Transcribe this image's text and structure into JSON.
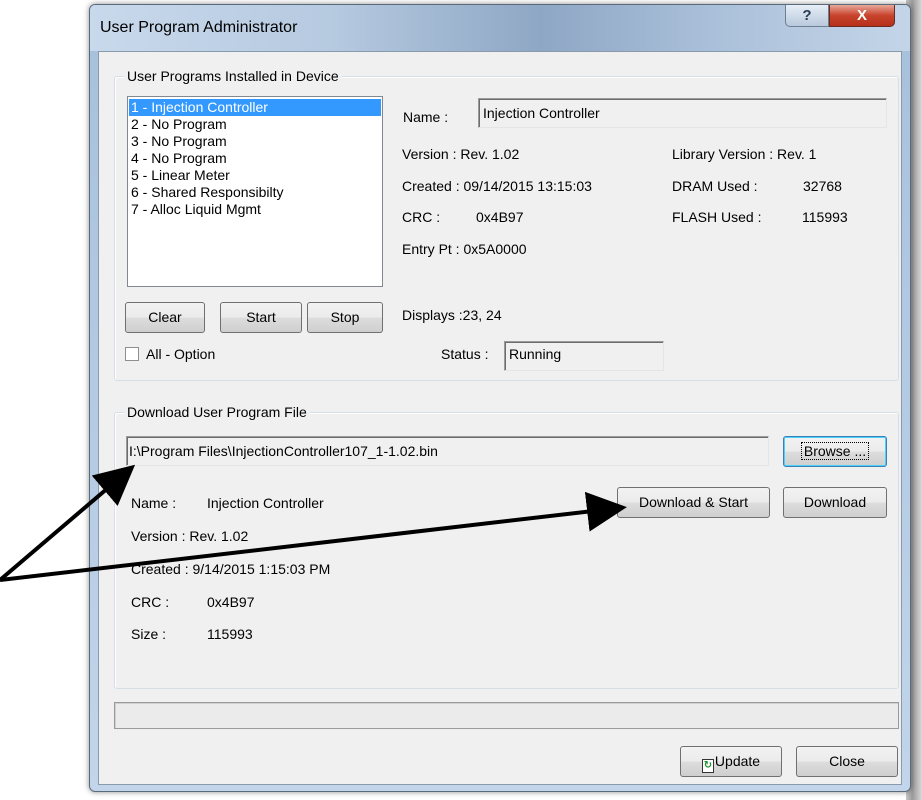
{
  "window": {
    "title": "User Program Administrator",
    "help_glyph": "?",
    "close_glyph": "X"
  },
  "installed": {
    "group_title": "User Programs Installed in Device",
    "programs": [
      "1 - Injection Controller",
      "2 - No Program",
      "3 - No Program",
      "4 - No Program",
      "5 - Linear Meter",
      "6 - Shared Responsibilty",
      "7 - Alloc Liquid Mgmt"
    ],
    "selected_index": 0,
    "name_label": "Name :",
    "name_value": "Injection Controller",
    "version": "Version : Rev. 1.02",
    "created": "Created : 09/14/2015 13:15:03",
    "crc_label": "CRC :",
    "crc_value": "0x4B97",
    "entry_pt": "Entry Pt : 0x5A0000",
    "library_version": "Library Version : Rev. 1",
    "dram_label": "DRAM Used :",
    "dram_value": "32768",
    "flash_label": "FLASH Used :",
    "flash_value": "115993",
    "displays": "Displays :23, 24",
    "status_label": "Status :",
    "status_value": "Running",
    "buttons": {
      "clear": "Clear",
      "start": "Start",
      "stop": "Stop"
    },
    "all_option_label": "All - Option",
    "all_option_checked": false
  },
  "download": {
    "group_title": "Download User Program File",
    "file_path": "I:\\Program Files\\InjectionController107_1-1.02.bin",
    "browse": "Browse ...",
    "download_start": "Download & Start",
    "download": "Download",
    "name_label": "Name :",
    "name_value": "Injection Controller",
    "version": "Version : Rev. 1.02",
    "created": "Created : 9/14/2015 1:15:03 PM",
    "crc_label": "CRC :",
    "crc_value": "0x4B97",
    "size_label": "Size :",
    "size_value": "115993"
  },
  "footer": {
    "progress_fraction": 0,
    "update_label": "Update",
    "close_label": "Close"
  },
  "colors": {
    "selection": "#3399ff",
    "annotation_arrow": "#000000",
    "close_button": "#c8432c"
  },
  "icons": {
    "update": "update-icon"
  }
}
